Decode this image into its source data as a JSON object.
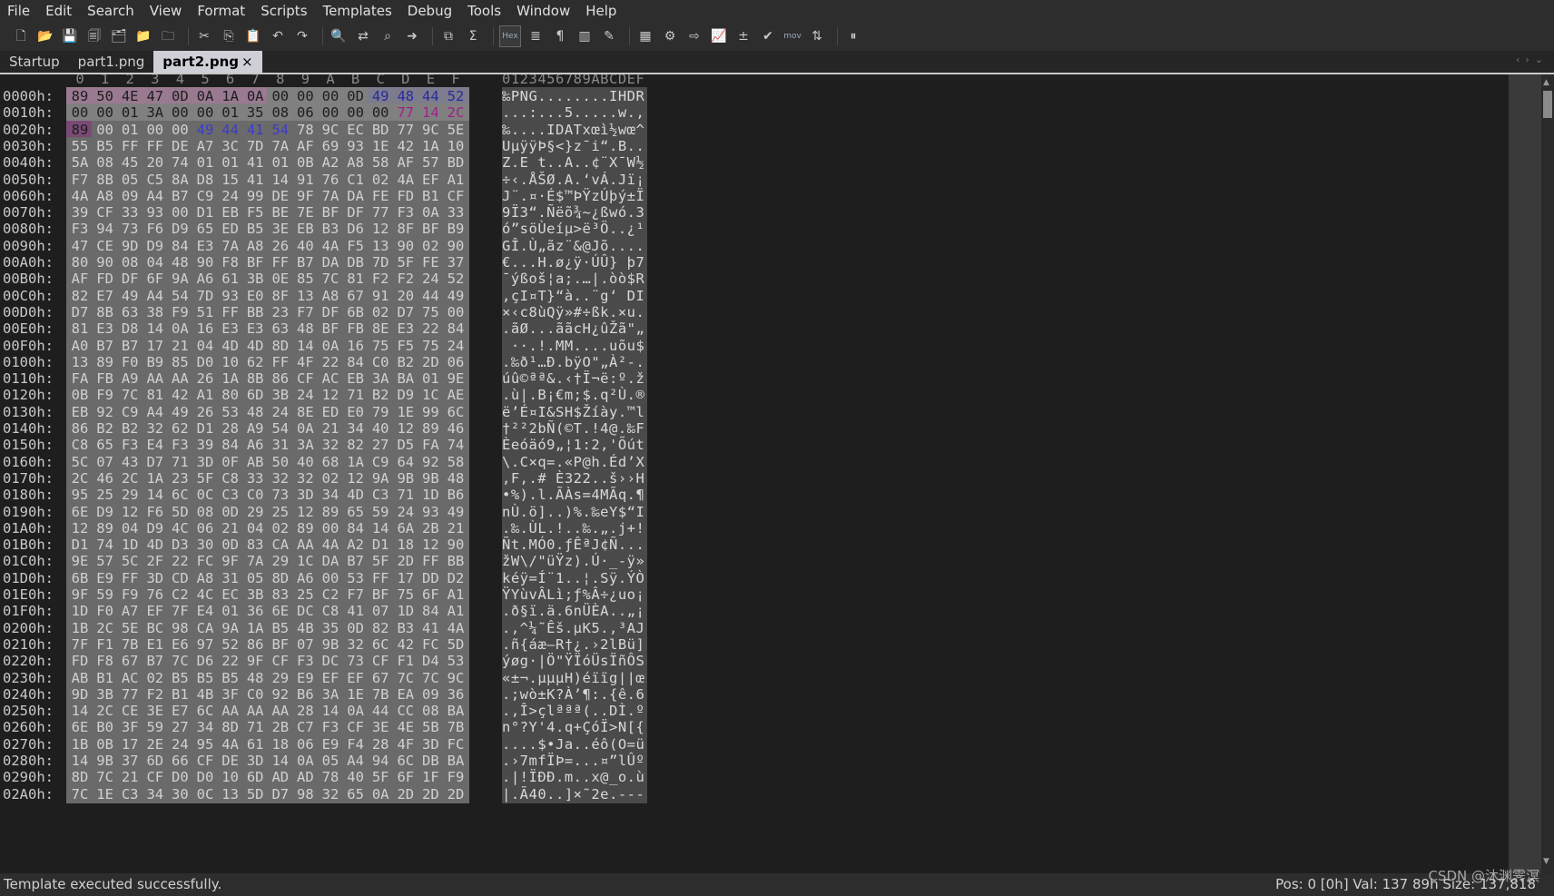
{
  "menu": [
    "File",
    "Edit",
    "Search",
    "View",
    "Format",
    "Scripts",
    "Templates",
    "Debug",
    "Tools",
    "Window",
    "Help"
  ],
  "toolbar": {
    "icons": [
      {
        "name": "new-file-icon",
        "glyph": "🗋"
      },
      {
        "name": "open-file-icon",
        "glyph": "📂"
      },
      {
        "name": "save-icon",
        "glyph": "💾"
      },
      {
        "name": "save-as-icon",
        "glyph": "🗐"
      },
      {
        "name": "save-all-icon",
        "glyph": "🗂"
      },
      {
        "name": "open-folder-icon",
        "glyph": "📁"
      },
      {
        "name": "close-file-icon",
        "glyph": "🗀"
      },
      {
        "name": "sep"
      },
      {
        "name": "cut-icon",
        "glyph": "✂"
      },
      {
        "name": "copy-icon",
        "glyph": "⎘"
      },
      {
        "name": "paste-icon",
        "glyph": "📋"
      },
      {
        "name": "undo-icon",
        "glyph": "↶"
      },
      {
        "name": "redo-icon",
        "glyph": "↷"
      },
      {
        "name": "sep"
      },
      {
        "name": "find-icon",
        "glyph": "🔍"
      },
      {
        "name": "replace-icon",
        "glyph": "⇄"
      },
      {
        "name": "find-in-files-icon",
        "glyph": "⌕"
      },
      {
        "name": "goto-icon",
        "glyph": "➜"
      },
      {
        "name": "sep"
      },
      {
        "name": "compare-icon",
        "glyph": "⧉"
      },
      {
        "name": "checksum-icon",
        "glyph": "Σ"
      },
      {
        "name": "sep"
      },
      {
        "name": "hex-mode-icon",
        "glyph": "Hex",
        "text": true,
        "hex": true
      },
      {
        "name": "text-mode-icon",
        "glyph": "≣"
      },
      {
        "name": "paragraph-icon",
        "glyph": "¶"
      },
      {
        "name": "columns-icon",
        "glyph": "▥"
      },
      {
        "name": "edit-mode-icon",
        "glyph": "✎"
      },
      {
        "name": "sep"
      },
      {
        "name": "calculator-icon",
        "glyph": "▦"
      },
      {
        "name": "base-converter-icon",
        "glyph": "⚙"
      },
      {
        "name": "import-icon",
        "glyph": "⇨"
      },
      {
        "name": "histogram-icon",
        "glyph": "📈"
      },
      {
        "name": "arithmetic-icon",
        "glyph": "±"
      },
      {
        "name": "run-template-icon",
        "glyph": "✔"
      },
      {
        "name": "mov-script-icon",
        "glyph": "mov",
        "text": true
      },
      {
        "name": "swap-bytes-icon",
        "glyph": "⇅"
      },
      {
        "name": "sep"
      },
      {
        "name": "pause-icon",
        "glyph": "⏸"
      }
    ]
  },
  "tabs": [
    {
      "label": "Startup",
      "active": false
    },
    {
      "label": "part1.png",
      "active": false
    },
    {
      "label": "part2.png",
      "active": true,
      "close": "×"
    }
  ],
  "hex": {
    "columns": [
      "0",
      "1",
      "2",
      "3",
      "4",
      "5",
      "6",
      "7",
      "8",
      "9",
      "A",
      "B",
      "C",
      "D",
      "E",
      "F"
    ],
    "ascii_header": "0123456789ABCDEF",
    "rows": [
      {
        "addr": "0000h:",
        "bytes": "89 50 4E 47 0D 0A 1A 0A 00 00 00 0D 49 48 44 52",
        "ascii": "‰PNG........IHDR"
      },
      {
        "addr": "0010h:",
        "bytes": "00 00 01 3A 00 00 01 35 08 06 00 00 00 77 14 2C",
        "ascii": "...:...5.....w.,"
      },
      {
        "addr": "0020h:",
        "bytes": "89 00 01 00 00 49 44 41 54 78 9C EC BD 77 9C 5E",
        "ascii": "‰....IDATxœì½wœ^"
      },
      {
        "addr": "0030h:",
        "bytes": "55 B5 FF FF DE A7 3C 7D 7A AF 69 93 1E 42 1A 10",
        "ascii": "UµÿÿÞ§<}z¯i“.B.."
      },
      {
        "addr": "0040h:",
        "bytes": "5A 08 45 20 74 01 01 41 01 0B A2 A8 58 AF 57 BD",
        "ascii": "Z.E t..A..¢¨X¯W½"
      },
      {
        "addr": "0050h:",
        "bytes": "F7 8B 05 C5 8A D8 15 41 14 91 76 C1 02 4A EF A1",
        "ascii": "÷‹.ÅŠØ.A.‘vÁ.Jï¡"
      },
      {
        "addr": "0060h:",
        "bytes": "4A A8 09 A4 B7 C9 24 99 DE 9F 7A DA FE FD B1 CF",
        "ascii": "J¨.¤·É$™ÞŸzÚþý±Ï"
      },
      {
        "addr": "0070h:",
        "bytes": "39 CF 33 93 00 D1 EB F5 BE 7E BF DF 77 F3 0A 33",
        "ascii": "9Ï3“.Ñëõ¾~¿ßwó.3"
      },
      {
        "addr": "0080h:",
        "bytes": "F3 94 73 F6 D9 65 ED B5 3E EB B3 D6 12 8F BF B9",
        "ascii": "ó”söÙeíµ>ë³Ö..¿¹"
      },
      {
        "addr": "0090h:",
        "bytes": "47 CE 9D D9 84 E3 7A A8 26 40 4A F5 13 90 02 90",
        "ascii": "GÎ.Ù„ãz¨&@Jõ...."
      },
      {
        "addr": "00A0h:",
        "bytes": "80 90 08 04 48 90 F8 BF FF B7 DA DB 7D 5F FE 37",
        "ascii": "€...H.ø¿ÿ·ÚÛ}_þ7"
      },
      {
        "addr": "00B0h:",
        "bytes": "AF FD DF 6F 9A A6 61 3B 0E 85 7C 81 F2 F2 24 52",
        "ascii": "¯ýßoš¦a;.…|.òò$R"
      },
      {
        "addr": "00C0h:",
        "bytes": "82 E7 49 A4 54 7D 93 E0 8F 13 A8 67 91 20 44 49",
        "ascii": "‚çI¤T}“à..¨g‘ DI"
      },
      {
        "addr": "00D0h:",
        "bytes": "D7 8B 63 38 F9 51 FF BB 23 F7 DF 6B 02 D7 75 00",
        "ascii": "×‹c8ùQÿ»#÷ßk.×u."
      },
      {
        "addr": "00E0h:",
        "bytes": "81 E3 D8 14 0A 16 E3 E3 63 48 BF FB 8E E3 22 84",
        "ascii": ".ãØ...ããcH¿ûŽã\"„"
      },
      {
        "addr": "00F0h:",
        "bytes": "A0 B7 B7 17 21 04 4D 4D 8D 14 0A 16 75 F5 75 24",
        "ascii": " ··.!.MM....uõu$"
      },
      {
        "addr": "0100h:",
        "bytes": "13 89 F0 B9 85 D0 10 62 FF 4F 22 84 C0 B2 2D 06",
        "ascii": ".‰ð¹…Ð.bÿO\"„À²-."
      },
      {
        "addr": "0110h:",
        "bytes": "FA FB A9 AA AA 26 1A 8B 86 CF AC EB 3A BA 01 9E",
        "ascii": "úû©ªª&.‹†Ï¬ë:º.ž"
      },
      {
        "addr": "0120h:",
        "bytes": "0B F9 7C 81 42 A1 80 6D 3B 24 12 71 B2 D9 1C AE",
        "ascii": ".ù|.B¡€m;$.q²Ù.®"
      },
      {
        "addr": "0130h:",
        "bytes": "EB 92 C9 A4 49 26 53 48 24 8E ED E0 79 1E 99 6C",
        "ascii": "ë’É¤I&SH$Žíày.™l"
      },
      {
        "addr": "0140h:",
        "bytes": "86 B2 B2 32 62 D1 28 A9 54 0A 21 34 40 12 89 46",
        "ascii": "†²²2bÑ(©T.!4@.‰F"
      },
      {
        "addr": "0150h:",
        "bytes": "C8 65 F3 E4 F3 39 84 A6 31 3A 32 82 27 D5 FA 74",
        "ascii": "Èeóäó9„¦1:2‚'Õút"
      },
      {
        "addr": "0160h:",
        "bytes": "5C 07 43 D7 71 3D 0F AB 50 40 68 1A C9 64 92 58",
        "ascii": "\\.C×q=.«P@h.Éd’X"
      },
      {
        "addr": "0170h:",
        "bytes": "2C 46 2C 1A 23 5F C8 33 32 32 02 12 9A 9B 9B 48",
        "ascii": ",F,.#_È322..š››H"
      },
      {
        "addr": "0180h:",
        "bytes": "95 25 29 14 6C 0C C3 C0 73 3D 34 4D C3 71 1D B6",
        "ascii": "•%).l.ÃÀs=4MÃq.¶"
      },
      {
        "addr": "0190h:",
        "bytes": "6E D9 12 F6 5D 08 0D 29 25 12 89 65 59 24 93 49",
        "ascii": "nÙ.ö]..)%.‰eY$“I"
      },
      {
        "addr": "01A0h:",
        "bytes": "12 89 04 D9 4C 06 21 04 02 89 00 84 14 6A 2B 21",
        "ascii": ".‰.ÙL.!..‰.„.j+!"
      },
      {
        "addr": "01B0h:",
        "bytes": "D1 74 1D 4D D3 30 0D 83 CA AA 4A A2 D1 18 12 90",
        "ascii": "Ñt.MÓ0.ƒÊªJ¢Ñ..."
      },
      {
        "addr": "01C0h:",
        "bytes": "9E 57 5C 2F 22 FC 9F 7A 29 1C DA B7 5F 2D FF BB",
        "ascii": "žW\\/\"üŸz).Ú·_-ÿ»"
      },
      {
        "addr": "01D0h:",
        "bytes": "6B E9 FF 3D CD A8 31 05 8D A6 00 53 FF 17 DD D2",
        "ascii": "kéÿ=Í¨1..¦.Sÿ.ÝÒ"
      },
      {
        "addr": "01E0h:",
        "bytes": "9F 59 F9 76 C2 4C EC 3B 83 25 C2 F7 BF 75 6F A1",
        "ascii": "ŸYùvÂLì;ƒ%Â÷¿uo¡"
      },
      {
        "addr": "01F0h:",
        "bytes": "1D F0 A7 EF 7F E4 01 36 6E DC C8 41 07 1D 84 A1",
        "ascii": ".ð§ï.ä.6nÜÈA..„¡"
      },
      {
        "addr": "0200h:",
        "bytes": "1B 2C 5E BC 98 CA 9A 1A B5 4B 35 0D 82 B3 41 4A",
        "ascii": ".,^¼˜Êš.µK5.‚³AJ"
      },
      {
        "addr": "0210h:",
        "bytes": "7F F1 7B E1 E6 97 52 86 BF 07 9B 32 6C 42 FC 5D",
        "ascii": ".ñ{áæ—R†¿.›2lBü]"
      },
      {
        "addr": "0220h:",
        "bytes": "FD F8 67 B7 7C D6 22 9F CF F3 DC 73 CF F1 D4 53",
        "ascii": "ýøg·|Ö\"ŸÏóÜsÏñÔS"
      },
      {
        "addr": "0230h:",
        "bytes": "AB B1 AC 02 B5 B5 B5 48 29 E9 EF EF 67 7C 7C 9C",
        "ascii": "«±¬.µµµH)éïïg||œ"
      },
      {
        "addr": "0240h:",
        "bytes": "9D 3B 77 F2 B1 4B 3F C0 92 B6 3A 1E 7B EA 09 36",
        "ascii": ".;wò±K?À’¶:.{ê.6"
      },
      {
        "addr": "0250h:",
        "bytes": "14 2C CE 3E E7 6C AA AA AA 28 14 0A 44 CC 08 BA",
        "ascii": ".,Î>çlªªª(..DÌ.º"
      },
      {
        "addr": "0260h:",
        "bytes": "6E B0 3F 59 27 34 8D 71 2B C7 F3 CF 3E 4E 5B 7B",
        "ascii": "n°?Y'4.q+ÇóÏ>N[{"
      },
      {
        "addr": "0270h:",
        "bytes": "1B 0B 17 2E 24 95 4A 61 18 06 E9 F4 28 4F 3D FC",
        "ascii": "....$•Ja..éô(O=ü"
      },
      {
        "addr": "0280h:",
        "bytes": "14 9B 37 6D 66 CF DE 3D 14 0A 05 A4 94 6C DB BA",
        "ascii": ".›7mfÏÞ=...¤”lÛº"
      },
      {
        "addr": "0290h:",
        "bytes": "8D 7C 21 CF D0 D0 10 6D AD AD 78 40 5F 6F 1F F9",
        "ascii": ".|!ÏÐÐ.m..x@_o.ù"
      },
      {
        "addr": "02A0h:",
        "bytes": "7C 1E C3 34 30 0C 13 5D D7 98 32 65 0A 2D 2D 2D",
        "ascii": "|.Ã40..]×˜2e.---"
      }
    ]
  },
  "status": {
    "left": "Template executed successfully.",
    "right": "Pos: 0 [0h]  Val: 137 89h  Size: 137,818"
  },
  "watermark": "CSDN @沐渊霁溟"
}
